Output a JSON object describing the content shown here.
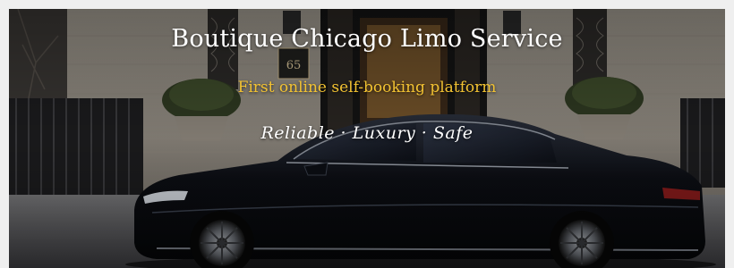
{
  "hero": {
    "title": "Boutique Chicago Limo Service",
    "subtitle": "First online self-booking platform",
    "tagline": "Reliable · Luxury · Safe",
    "building_number": "65"
  },
  "colors": {
    "title": "#ffffff",
    "subtitle": "#f2c232",
    "tagline": "#ffffff",
    "car_body": "#0b0d12",
    "stone_facade": "#b9b2a6"
  }
}
